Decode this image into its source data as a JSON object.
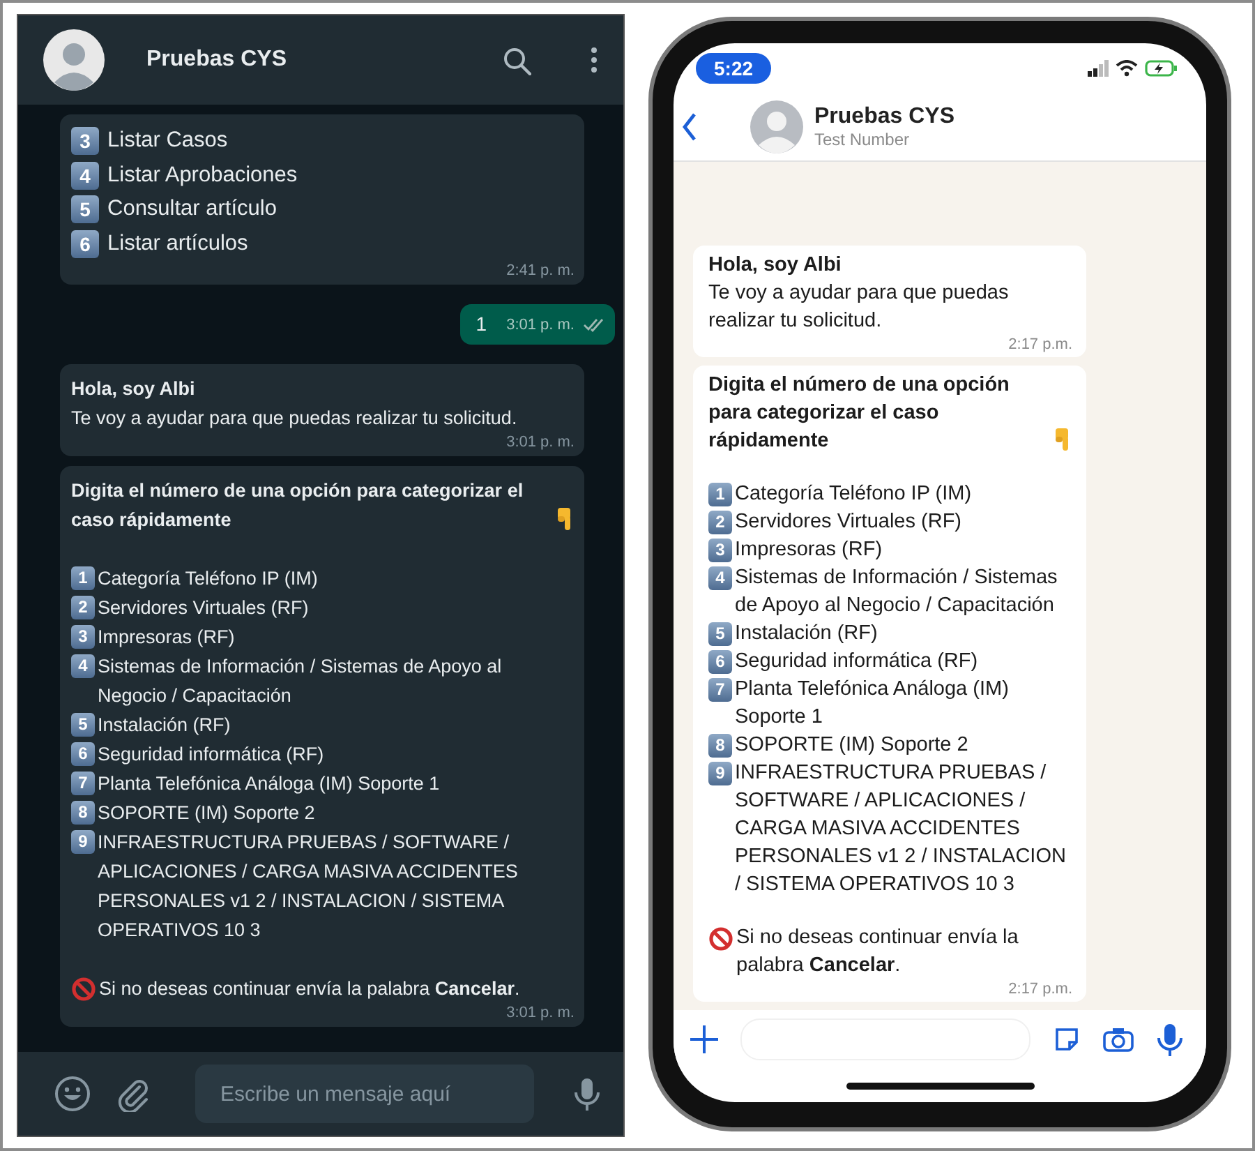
{
  "whatsapp_web": {
    "header": {
      "title": "Pruebas CYS"
    },
    "messages": [
      {
        "kind": "menu_list",
        "options": [
          {
            "key": "3",
            "text": "Listar Casos"
          },
          {
            "key": "4",
            "text": "Listar Aprobaciones"
          },
          {
            "key": "5",
            "text": "Consultar artículo"
          },
          {
            "key": "6",
            "text": "Listar artículos"
          }
        ],
        "time": "2:41 p. m."
      },
      {
        "kind": "sent",
        "text": "1",
        "time": "3:01 p. m.",
        "read": false
      },
      {
        "kind": "greeting",
        "title": "Hola, soy Albi",
        "text": "Te voy a ayudar para que puedas realizar tu solicitud.",
        "time": "3:01 p. m."
      },
      {
        "kind": "categories",
        "title": "Digita el número de una opción para categorizar el caso rápidamente",
        "options": [
          {
            "key": "1",
            "text": "Categoría Teléfono IP (IM)"
          },
          {
            "key": "2",
            "text": "Servidores Virtuales (RF)"
          },
          {
            "key": "3",
            "text": "Impresoras (RF)"
          },
          {
            "key": "4",
            "text": "Sistemas de Información / Sistemas de Apoyo al Negocio / Capacitación"
          },
          {
            "key": "5",
            "text": "Instalación (RF)"
          },
          {
            "key": "6",
            "text": "Seguridad informática (RF)"
          },
          {
            "key": "7",
            "text": "Planta Telefónica Análoga (IM) Soporte 1"
          },
          {
            "key": "8",
            "text": "SOPORTE (IM) Soporte 2"
          },
          {
            "key": "9",
            "text": "INFRAESTRUCTURA PRUEBAS / SOFTWARE / APLICACIONES / CARGA MASIVA ACCIDENTES PERSONALES v1 2 / INSTALACION / SISTEMA OPERATIVOS 10 3"
          }
        ],
        "footer": "Si no deseas continuar envía la palabra **Cancelar**.",
        "time": "3:01 p. m."
      }
    ],
    "composer": {
      "placeholder": "Escribe un mensaje aquí"
    }
  },
  "phone": {
    "status_bar": {
      "time": "5:22"
    },
    "header": {
      "title": "Pruebas CYS",
      "subtitle": "Test Number"
    },
    "messages": [
      {
        "kind": "greeting",
        "title": "Hola, soy Albi",
        "text": "Te voy a ayudar para que puedas realizar tu solicitud.",
        "time": "2:17 p.m."
      },
      {
        "kind": "categories",
        "title": "Digita el número de una opción para categorizar el caso rápidamente",
        "options": [
          {
            "key": "1",
            "text": "Categoría Teléfono IP (IM)"
          },
          {
            "key": "2",
            "text": "Servidores Virtuales (RF)"
          },
          {
            "key": "3",
            "text": "Impresoras (RF)"
          },
          {
            "key": "4",
            "text": "Sistemas de Información / Sistemas de Apoyo al Negocio / Capacitación"
          },
          {
            "key": "5",
            "text": "Instalación (RF)"
          },
          {
            "key": "6",
            "text": "Seguridad informática (RF)"
          },
          {
            "key": "7",
            "text": "Planta Telefónica Análoga (IM) Soporte 1"
          },
          {
            "key": "8",
            "text": "SOPORTE (IM) Soporte 2"
          },
          {
            "key": "9",
            "text": "INFRAESTRUCTURA PRUEBAS / SOFTWARE / APLICACIONES / CARGA MASIVA ACCIDENTES PERSONALES v1 2 / INSTALACION / SISTEMA OPERATIVOS 10 3"
          }
        ],
        "footer": "Si no deseas continuar envía la palabra **Cancelar**.",
        "time": "2:17 p.m."
      }
    ]
  }
}
